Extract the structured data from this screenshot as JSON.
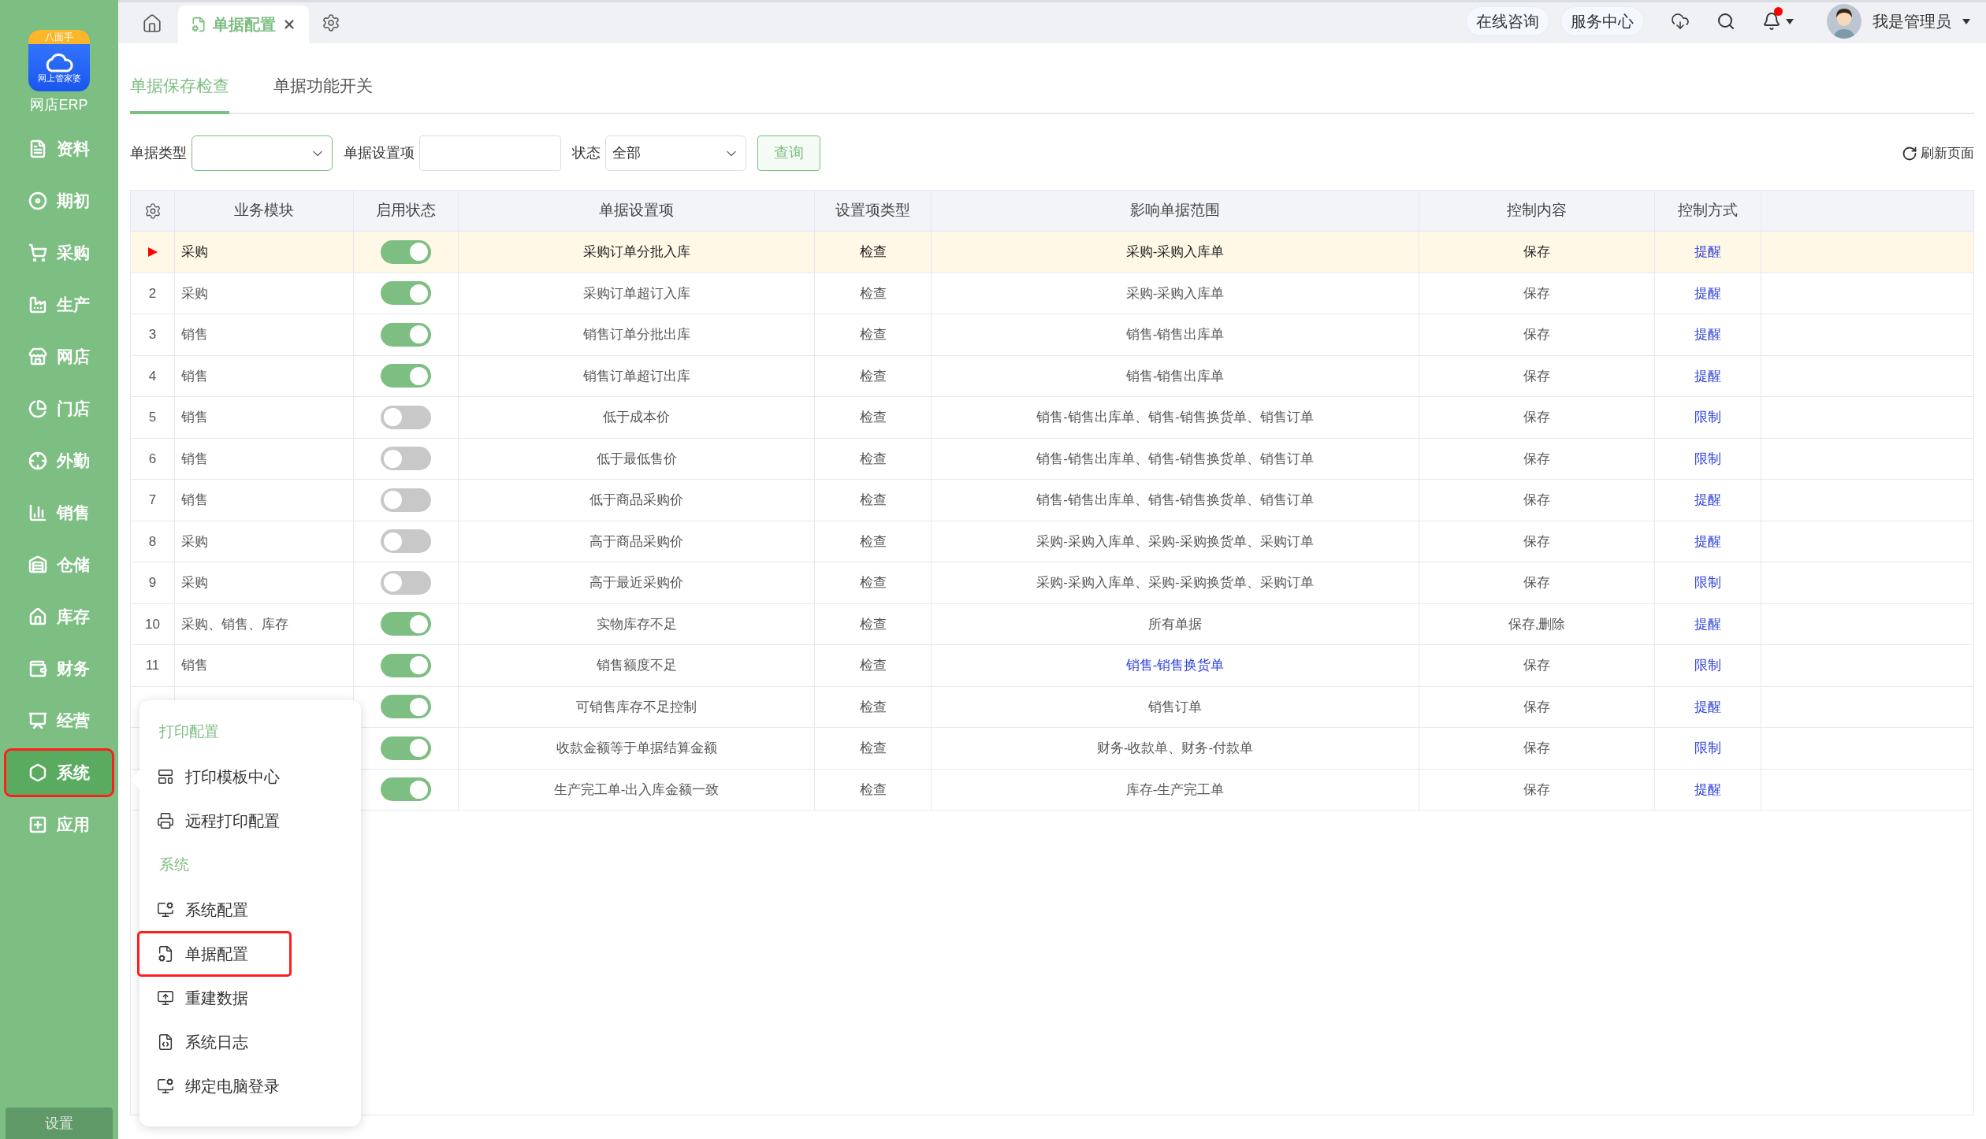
{
  "sidebar": {
    "logo_badge": "八面手",
    "logo_caption": "网上管家婆",
    "app_name": "网店ERP",
    "items": [
      {
        "label": "资料",
        "kind": "doc",
        "selected": false,
        "highlighted": false
      },
      {
        "label": "期初",
        "kind": "ring",
        "selected": false,
        "highlighted": false
      },
      {
        "label": "采购",
        "kind": "cart",
        "selected": false,
        "highlighted": false
      },
      {
        "label": "生产",
        "kind": "factory",
        "selected": false,
        "highlighted": false
      },
      {
        "label": "网店",
        "kind": "store",
        "selected": false,
        "highlighted": false
      },
      {
        "label": "门店",
        "kind": "pie",
        "selected": false,
        "highlighted": false
      },
      {
        "label": "外勤",
        "kind": "target",
        "selected": false,
        "highlighted": false
      },
      {
        "label": "销售",
        "kind": "bars",
        "selected": false,
        "highlighted": false
      },
      {
        "label": "仓储",
        "kind": "warehouse",
        "selected": false,
        "highlighted": false
      },
      {
        "label": "库存",
        "kind": "home",
        "selected": false,
        "highlighted": false
      },
      {
        "label": "财务",
        "kind": "wallet",
        "selected": false,
        "highlighted": false
      },
      {
        "label": "经营",
        "kind": "board",
        "selected": false,
        "highlighted": false
      },
      {
        "label": "系统",
        "kind": "hexagon",
        "selected": true,
        "highlighted": true
      },
      {
        "label": "应用",
        "kind": "plus",
        "selected": false,
        "highlighted": false
      }
    ],
    "footer_button": "设置"
  },
  "top_bar": {
    "tabs": [
      {
        "label": "单据配置",
        "selected": true
      }
    ],
    "buttons": [
      "在线咨询",
      "服务中心"
    ],
    "notification_dot": true,
    "user": "我是管理员"
  },
  "page_tabs": [
    {
      "label": "单据保存检查",
      "selected": true
    },
    {
      "label": "单据功能开关",
      "selected": false
    }
  ],
  "filters": [
    {
      "label": "单据类型",
      "kind": "select"
    },
    {
      "label": "单据设置项",
      "kind": "input"
    },
    {
      "label": "状态",
      "kind": "select",
      "value": "全部"
    }
  ],
  "query_button": "查询",
  "refresh_button": "刷新页面",
  "table": {
    "columns": [
      "业务模块",
      "启用状态",
      "单据设置项",
      "设置项类型",
      "影响单据范围",
      "控制内容",
      "控制方式"
    ],
    "rows": [
      {
        "module": "采购",
        "enabled": true,
        "item": "采购订单分批入库",
        "type": "检查",
        "scope": "采购-采购入库单",
        "scope_link": false,
        "content": "保存",
        "method": "提醒",
        "selected": true
      },
      {
        "number": "2",
        "module": "采购",
        "enabled": true,
        "item": "采购订单超订入库",
        "type": "检查",
        "scope": "采购-采购入库单",
        "scope_link": false,
        "content": "保存",
        "method": "提醒",
        "selected": false
      },
      {
        "number": "3",
        "module": "销售",
        "enabled": true,
        "item": "销售订单分批出库",
        "type": "检查",
        "scope": "销售-销售出库单",
        "scope_link": false,
        "content": "保存",
        "method": "提醒",
        "selected": false
      },
      {
        "number": "4",
        "module": "销售",
        "enabled": true,
        "item": "销售订单超订出库",
        "type": "检查",
        "scope": "销售-销售出库单",
        "scope_link": false,
        "content": "保存",
        "method": "提醒",
        "selected": false
      },
      {
        "number": "5",
        "module": "销售",
        "enabled": false,
        "item": "低于成本价",
        "type": "检查",
        "scope": "销售-销售出库单、销售-销售换货单、销售订单",
        "scope_link": false,
        "content": "保存",
        "method": "限制",
        "selected": false
      },
      {
        "number": "6",
        "module": "销售",
        "enabled": false,
        "item": "低于最低售价",
        "type": "检查",
        "scope": "销售-销售出库单、销售-销售换货单、销售订单",
        "scope_link": false,
        "content": "保存",
        "method": "限制",
        "selected": false
      },
      {
        "number": "7",
        "module": "销售",
        "enabled": false,
        "item": "低于商品采购价",
        "type": "检查",
        "scope": "销售-销售出库单、销售-销售换货单、销售订单",
        "scope_link": false,
        "content": "保存",
        "method": "提醒",
        "selected": false
      },
      {
        "number": "8",
        "module": "采购",
        "enabled": false,
        "item": "高于商品采购价",
        "type": "检查",
        "scope": "采购-采购入库单、采购-采购换货单、采购订单",
        "scope_link": false,
        "content": "保存",
        "method": "提醒",
        "selected": false
      },
      {
        "number": "9",
        "module": "采购",
        "enabled": false,
        "item": "高于最近采购价",
        "type": "检查",
        "scope": "采购-采购入库单、采购-采购换货单、采购订单",
        "scope_link": false,
        "content": "保存",
        "method": "限制",
        "selected": false
      },
      {
        "number": "10",
        "module": "采购、销售、库存",
        "enabled": true,
        "item": "实物库存不足",
        "type": "检查",
        "scope": "所有单据",
        "scope_link": false,
        "content": "保存,删除",
        "method": "提醒",
        "selected": false
      },
      {
        "number": "11",
        "module": "销售",
        "enabled": true,
        "item": "销售额度不足",
        "type": "检查",
        "scope": "销售-销售换货单",
        "scope_link": true,
        "content": "保存",
        "method": "限制",
        "selected": false
      },
      {
        "enabled": true,
        "item": "可销售库存不足控制",
        "type": "检查",
        "scope": "销售订单",
        "scope_link": false,
        "content": "保存",
        "method": "提醒",
        "selected": false
      },
      {
        "enabled": true,
        "item": "收款金额等于单据结算金额",
        "type": "检查",
        "scope": "财务-收款单、财务-付款单",
        "scope_link": false,
        "content": "保存",
        "method": "限制",
        "selected": false
      },
      {
        "enabled": true,
        "item": "生产完工单-出入库金额一致",
        "type": "检查",
        "scope": "库存-生产完工单",
        "scope_link": false,
        "content": "保存",
        "method": "提醒",
        "selected": false
      }
    ]
  },
  "popup_menu": {
    "sections": [
      {
        "title": "打印配置",
        "items": [
          {
            "label": "打印模板中心",
            "kind": "template",
            "highlighted": false
          },
          {
            "label": "远程打印配置",
            "kind": "printer",
            "highlighted": false
          }
        ]
      },
      {
        "title": "系统",
        "items": [
          {
            "label": "系统配置",
            "kind": "screen-gear",
            "highlighted": false
          },
          {
            "label": "单据配置",
            "kind": "doc-gear",
            "highlighted": true
          },
          {
            "label": "重建数据",
            "kind": "screen-undo",
            "highlighted": false
          },
          {
            "label": "系统日志",
            "kind": "code-file",
            "highlighted": false
          },
          {
            "label": "绑定电脑登录",
            "kind": "screen-gear",
            "highlighted": false
          }
        ]
      }
    ]
  }
}
